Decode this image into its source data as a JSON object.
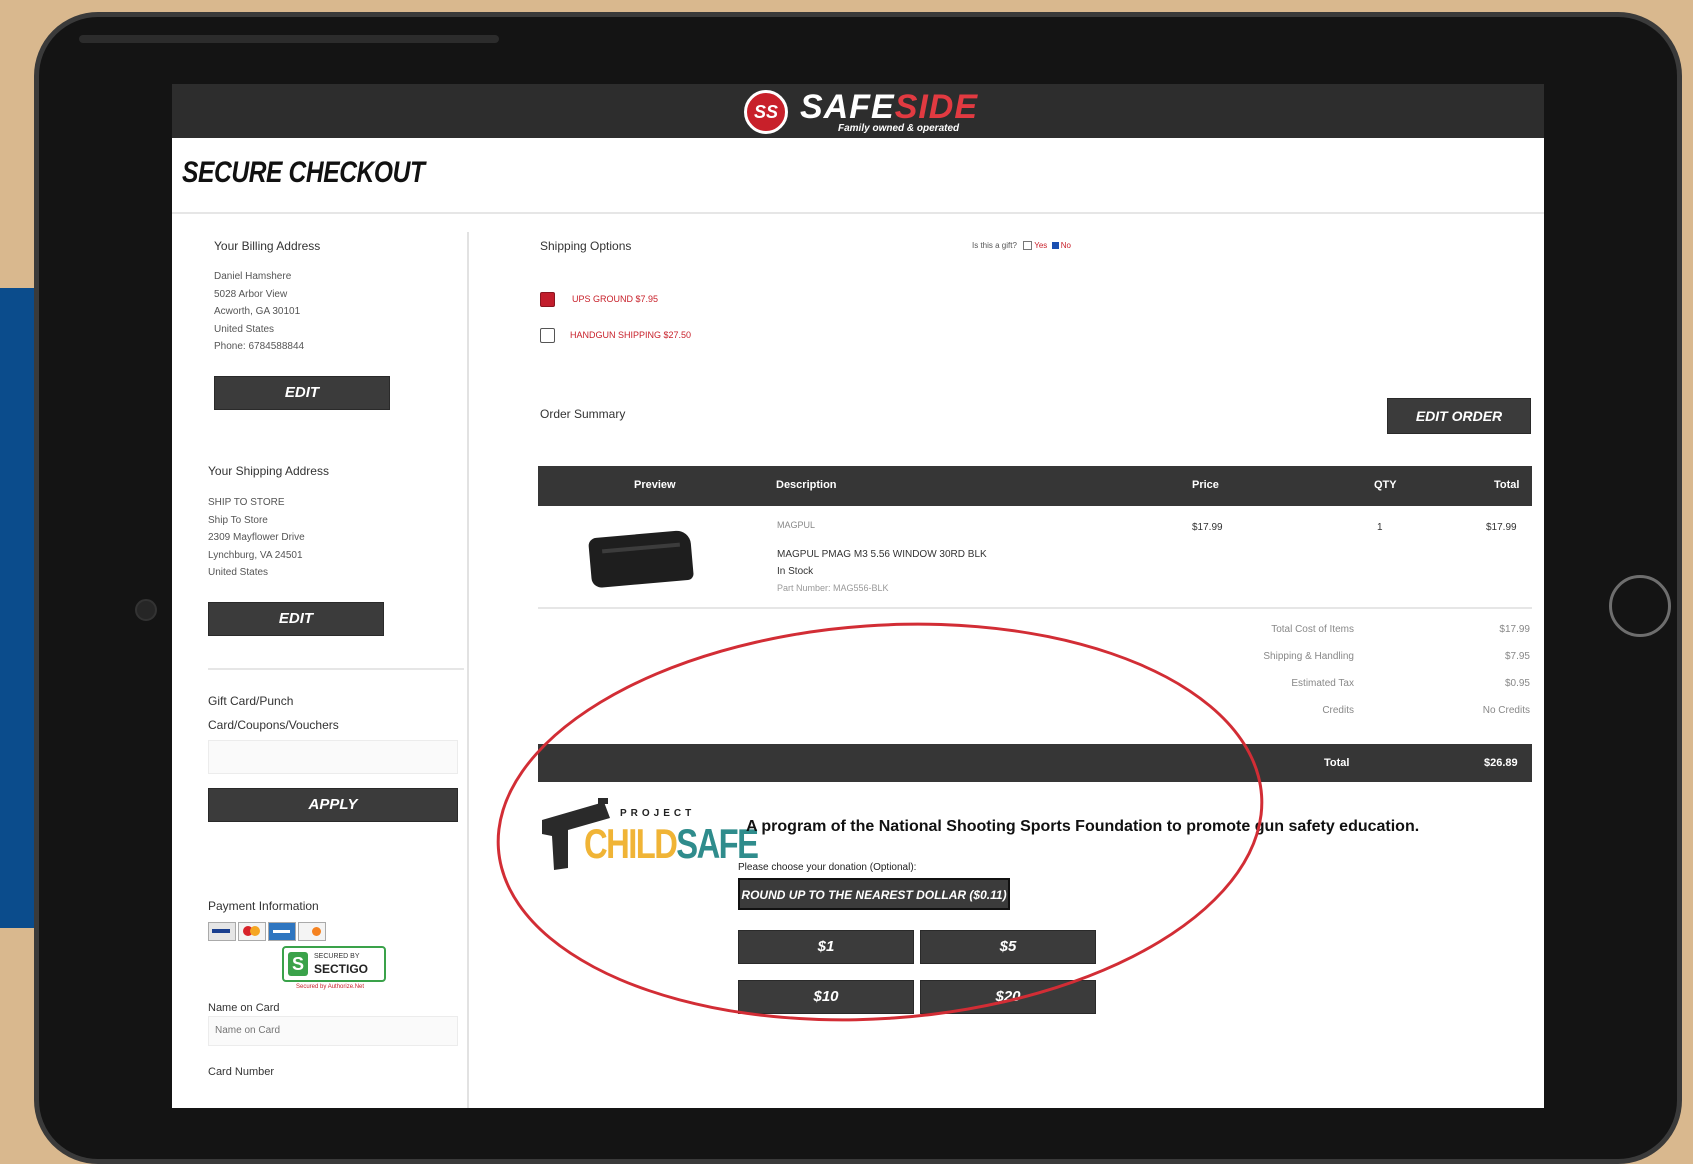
{
  "brand": {
    "logo_mark": "SS",
    "name_part1": "SAFE",
    "name_part2": "SIDE",
    "tagline": "Family owned & operated",
    "colors": {
      "brand_red": "#c8202a",
      "header_dark": "#2d2d2d",
      "childsafe_yellow": "#f0b436",
      "childsafe_teal": "#2f8c8c",
      "annotation_red": "#d22d35"
    }
  },
  "page_title": "SECURE CHECKOUT",
  "billing": {
    "heading": "Your Billing Address",
    "lines": [
      "Daniel Hamshere",
      "5028 Arbor View",
      "Acworth, GA 30101",
      "United States",
      "Phone: 6784588844"
    ],
    "edit_label": "EDIT"
  },
  "shipping_address": {
    "heading": "Your Shipping Address",
    "lines": [
      "SHIP TO STORE",
      "Ship To Store",
      "2309 Mayflower Drive",
      "Lynchburg, VA 24501",
      "United States"
    ],
    "edit_label": "EDIT"
  },
  "gift_card": {
    "label_line1": "Gift Card/Punch",
    "label_line2": "Card/Coupons/Vouchers",
    "input_value": "",
    "apply_label": "APPLY"
  },
  "payment": {
    "heading": "Payment Information",
    "card_icons": [
      "visa-card-icon",
      "mastercard-icon",
      "amex-card-icon",
      "discover-card-icon"
    ],
    "secured_by": "SECURED BY",
    "secured_brand": "SECTIGO",
    "secured_sub": "Secured by Authorize.Net",
    "name_label": "Name on Card",
    "name_placeholder": "Name on Card",
    "card_number_label": "Card Number"
  },
  "shipping_options": {
    "heading": "Shipping Options",
    "gift_question": "Is this a gift?",
    "gift_yes": "Yes",
    "gift_no": "No",
    "options": [
      {
        "label": "UPS GROUND $7.95",
        "checked": true
      },
      {
        "label": "HANDGUN SHIPPING $27.50",
        "checked": false
      }
    ]
  },
  "order_summary": {
    "heading": "Order Summary",
    "edit_order_label": "EDIT ORDER",
    "columns": [
      "Preview",
      "Description",
      "Price",
      "QTY",
      "Total"
    ],
    "item": {
      "brand": "MAGPUL",
      "name": "MAGPUL PMAG M3 5.56 WINDOW 30RD BLK",
      "stock": "In Stock",
      "part_number": "Part Number: MAG556-BLK",
      "price": "$17.99",
      "qty": "1",
      "total": "$17.99"
    },
    "summary_rows": [
      {
        "label": "Total Cost of Items",
        "value": "$17.99"
      },
      {
        "label": "Shipping & Handling",
        "value": "$7.95"
      },
      {
        "label": "Estimated Tax",
        "value": "$0.95"
      },
      {
        "label": "Credits",
        "value": "No Credits"
      }
    ],
    "total_label": "Total",
    "total_value": "$26.89"
  },
  "donation": {
    "logo_project": "PROJECT",
    "logo_child": "CHILD",
    "logo_safe": "SAFE",
    "program_text": "A program of the National Shooting Sports Foundation to promote gun safety education.",
    "prompt": "Please choose your donation (Optional):",
    "round_up_label": "ROUND UP TO THE NEAREST DOLLAR ($0.11)",
    "amounts": [
      "$1",
      "$5",
      "$10",
      "$20"
    ]
  }
}
